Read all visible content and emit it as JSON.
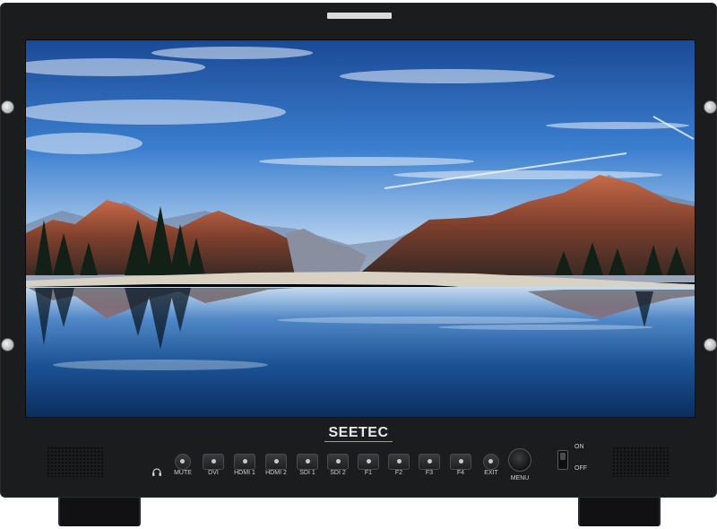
{
  "brand": {
    "name": "SEETEC"
  },
  "controls": {
    "buttons": [
      {
        "id": "mute",
        "label": "MUTE"
      },
      {
        "id": "dvi",
        "label": "DVI"
      },
      {
        "id": "hdmi1",
        "label": "HDMI 1"
      },
      {
        "id": "hdmi2",
        "label": "HDMI 2"
      },
      {
        "id": "sdi1",
        "label": "SDI 1"
      },
      {
        "id": "sdi2",
        "label": "SDI 2"
      },
      {
        "id": "f1",
        "label": "F1"
      },
      {
        "id": "f2",
        "label": "F2"
      },
      {
        "id": "f3",
        "label": "F3"
      },
      {
        "id": "f4",
        "label": "F4"
      },
      {
        "id": "exit",
        "label": "EXIT"
      }
    ],
    "menu_label": "MENU",
    "power_on_label": "ON",
    "power_off_label": "OFF"
  },
  "icons": {
    "headphone": "headphone-icon",
    "mute_button": "button-dot-icon",
    "menu_knob": "rotary-knob-icon",
    "power": "toggle-switch-icon",
    "speaker": "speaker-grille"
  },
  "colors": {
    "bezel": "#1b1c1e",
    "sky_top": "#1b4f9c",
    "sky_horizon": "#cfe0f3",
    "mountain_lit": "#b5573a",
    "lake": "#0d3f7a"
  }
}
